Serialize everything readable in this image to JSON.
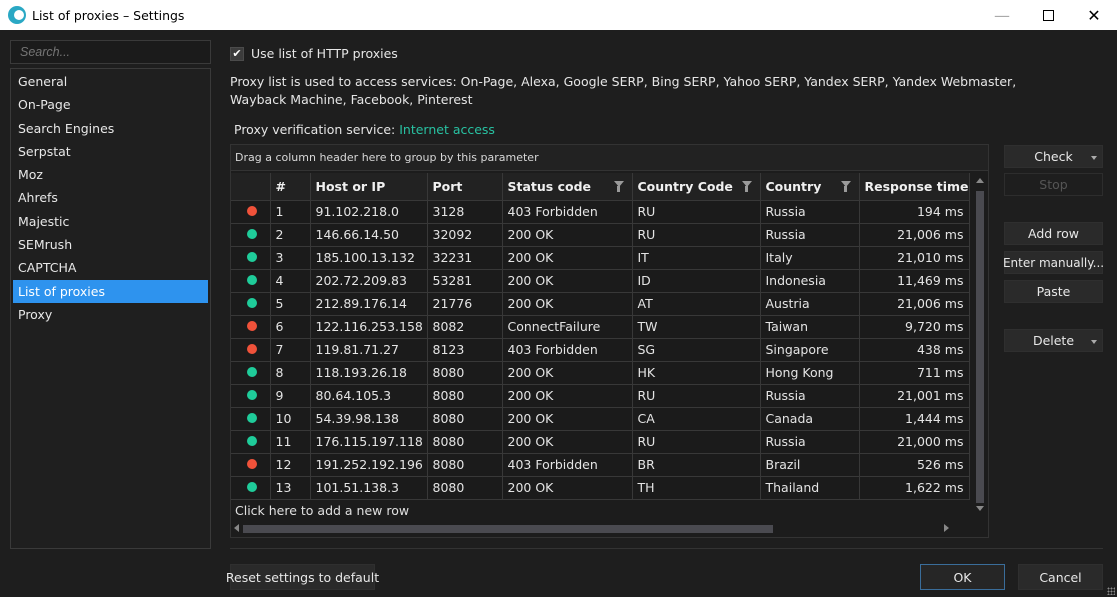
{
  "window": {
    "title": "List of proxies – Settings",
    "controls": [
      "minimize",
      "maximize",
      "close"
    ]
  },
  "sidebar": {
    "search_placeholder": "Search...",
    "items": [
      {
        "label": "General"
      },
      {
        "label": "On-Page"
      },
      {
        "label": "Search Engines"
      },
      {
        "label": "Serpstat"
      },
      {
        "label": "Moz"
      },
      {
        "label": "Ahrefs"
      },
      {
        "label": "Majestic"
      },
      {
        "label": "SEMrush"
      },
      {
        "label": "CAPTCHA"
      },
      {
        "label": "List of proxies",
        "active": true
      },
      {
        "label": "Proxy"
      }
    ]
  },
  "main": {
    "use_proxies_label": "Use list of HTTP proxies",
    "use_proxies_checked": true,
    "description": "Proxy list is used to access services: On-Page, Alexa, Google SERP, Bing SERP, Yahoo SERP, Yandex SERP, Yandex Webmaster, Wayback Machine, Facebook, Pinterest",
    "verification_label": "Proxy verification service:",
    "verification_link": "Internet access",
    "group_hint": "Drag a column header here to group by this parameter",
    "add_row_hint": "Click here to add a new row"
  },
  "table": {
    "columns": [
      "",
      "#",
      "Host or IP",
      "Port",
      "Status code",
      "Country Code",
      "Country",
      "Response time"
    ],
    "rows": [
      {
        "status": "error",
        "num": "1",
        "host": "91.102.218.0",
        "port": "3128",
        "code": "403 Forbidden",
        "cc": "RU",
        "country": "Russia",
        "time": "194 ms"
      },
      {
        "status": "ok",
        "num": "2",
        "host": "146.66.14.50",
        "port": "32092",
        "code": "200 OK",
        "cc": "RU",
        "country": "Russia",
        "time": "21,006 ms"
      },
      {
        "status": "ok",
        "num": "3",
        "host": "185.100.13.132",
        "port": "32231",
        "code": "200 OK",
        "cc": "IT",
        "country": "Italy",
        "time": "21,010 ms"
      },
      {
        "status": "ok",
        "num": "4",
        "host": "202.72.209.83",
        "port": "53281",
        "code": "200 OK",
        "cc": "ID",
        "country": "Indonesia",
        "time": "11,469 ms"
      },
      {
        "status": "ok",
        "num": "5",
        "host": "212.89.176.14",
        "port": "21776",
        "code": "200 OK",
        "cc": "AT",
        "country": "Austria",
        "time": "21,006 ms"
      },
      {
        "status": "error",
        "num": "6",
        "host": "122.116.253.158",
        "port": "8082",
        "code": "ConnectFailure",
        "cc": "TW",
        "country": "Taiwan",
        "time": "9,720 ms"
      },
      {
        "status": "error",
        "num": "7",
        "host": "119.81.71.27",
        "port": "8123",
        "code": "403 Forbidden",
        "cc": "SG",
        "country": "Singapore",
        "time": "438 ms"
      },
      {
        "status": "ok",
        "num": "8",
        "host": "118.193.26.18",
        "port": "8080",
        "code": "200 OK",
        "cc": "HK",
        "country": "Hong Kong",
        "time": "711 ms"
      },
      {
        "status": "ok",
        "num": "9",
        "host": "80.64.105.3",
        "port": "8080",
        "code": "200 OK",
        "cc": "RU",
        "country": "Russia",
        "time": "21,001 ms"
      },
      {
        "status": "ok",
        "num": "10",
        "host": "54.39.98.138",
        "port": "8080",
        "code": "200 OK",
        "cc": "CA",
        "country": "Canada",
        "time": "1,444 ms"
      },
      {
        "status": "ok",
        "num": "11",
        "host": "176.115.197.118",
        "port": "8080",
        "code": "200 OK",
        "cc": "RU",
        "country": "Russia",
        "time": "21,000 ms"
      },
      {
        "status": "error",
        "num": "12",
        "host": "191.252.192.196",
        "port": "8080",
        "code": "403 Forbidden",
        "cc": "BR",
        "country": "Brazil",
        "time": "526 ms"
      },
      {
        "status": "ok",
        "num": "13",
        "host": "101.51.138.3",
        "port": "8080",
        "code": "200 OK",
        "cc": "TH",
        "country": "Thailand",
        "time": "1,622 ms"
      }
    ]
  },
  "actions": {
    "check": "Check",
    "stop": "Stop",
    "add_row": "Add row",
    "enter_manually": "Enter manually...",
    "paste": "Paste",
    "delete": "Delete"
  },
  "footer": {
    "reset": "Reset settings to default",
    "ok": "OK",
    "cancel": "Cancel"
  },
  "colors": {
    "accent": "#2e93ee",
    "link": "#28c2a2",
    "status_ok": "#1fcc9a",
    "status_error": "#f0523a"
  }
}
